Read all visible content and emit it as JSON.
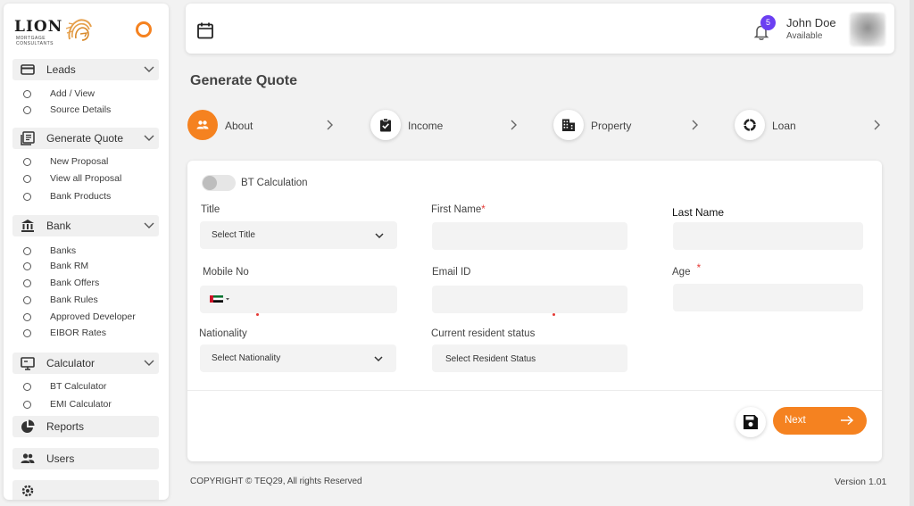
{
  "logo": {
    "name": "LION",
    "subtitle": "MORTGAGE CONSULTANTS"
  },
  "sidebar": {
    "groups": [
      {
        "label": "Leads",
        "items": [
          "Add / View",
          "Source Details"
        ]
      },
      {
        "label": "Generate Quote",
        "items": [
          "New Proposal",
          "View all Proposal",
          "Bank Products"
        ]
      },
      {
        "label": "Bank",
        "items": [
          "Banks",
          "Bank RM",
          "Bank Offers",
          "Bank Rules",
          "Approved Developer",
          "EIBOR Rates"
        ]
      },
      {
        "label": "Calculator",
        "items": [
          "BT Calculator",
          "EMI Calculator"
        ]
      }
    ],
    "links": [
      {
        "label": "Reports"
      },
      {
        "label": "Users"
      }
    ]
  },
  "header": {
    "notification_count": "5",
    "user_name": "John Doe",
    "user_status": "Available"
  },
  "page": {
    "title": "Generate Quote"
  },
  "steps": [
    {
      "label": "About"
    },
    {
      "label": "Income"
    },
    {
      "label": "Property"
    },
    {
      "label": "Loan"
    }
  ],
  "form": {
    "toggle_label": "BT Calculation",
    "title_label": "Title",
    "title_value": "Select Title",
    "first_name_label": "First Name",
    "last_name_label": "Last Name",
    "mobile_label": "Mobile No",
    "email_label": "Email ID",
    "age_label": "Age",
    "nationality_label": "Nationality",
    "nationality_value": "Select Nationality",
    "resident_label": "Current resident status",
    "resident_value": "Select Resident Status",
    "required_mark": "*",
    "next_label": "Next"
  },
  "footer": {
    "copyright": "COPYRIGHT © TEQ29, All rights Reserved",
    "version": "Version  1.01"
  },
  "colors": {
    "accent": "#f58220",
    "badge": "#6b3ff2",
    "required": "#e53935"
  }
}
